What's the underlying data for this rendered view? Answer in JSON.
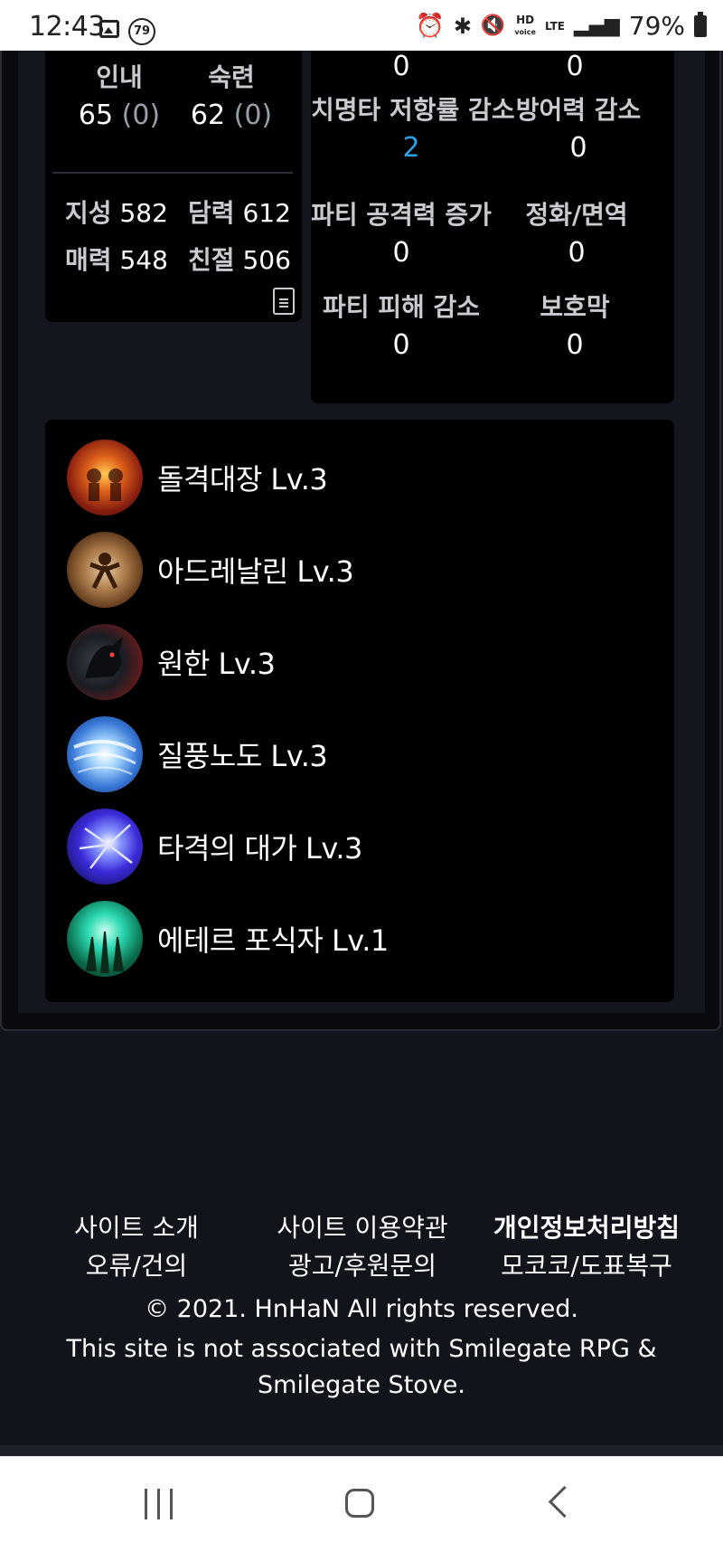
{
  "status_bar": {
    "time": "12:43",
    "notification_count": "79",
    "hd_label": "HD",
    "voice_label": "voice",
    "network_label": "LTE",
    "battery_percent": "79%"
  },
  "stats_card": {
    "stats": [
      {
        "label": "인내",
        "value": "65",
        "bonus": "(0)"
      },
      {
        "label": "숙련",
        "value": "62",
        "bonus": "(0)"
      }
    ],
    "tendencies": [
      {
        "label": "지성",
        "value": "582"
      },
      {
        "label": "담력",
        "value": "612"
      },
      {
        "label": "매력",
        "value": "548"
      },
      {
        "label": "친절",
        "value": "506"
      }
    ]
  },
  "combat_card": {
    "top_values": [
      "0",
      "0"
    ],
    "items": [
      {
        "label": "치명타 저항률 감소",
        "value": "2"
      },
      {
        "label": "방어력 감소",
        "value": "0"
      },
      {
        "label": "파티 공격력 증가",
        "value": "0"
      },
      {
        "label": "정화/면역",
        "value": "0"
      },
      {
        "label": "파티 피해 감소",
        "value": "0"
      },
      {
        "label": "보호막",
        "value": "0"
      }
    ],
    "highlight_color": "#2aa2e8"
  },
  "engravings": [
    {
      "name": "돌격대장 Lv.3",
      "icon": "charge-leader-icon"
    },
    {
      "name": "아드레날린 Lv.3",
      "icon": "adrenaline-icon"
    },
    {
      "name": "원한 Lv.3",
      "icon": "grudge-icon"
    },
    {
      "name": "질풍노도 Lv.3",
      "icon": "raging-wind-icon"
    },
    {
      "name": "타격의 대가 Lv.3",
      "icon": "master-of-strikes-icon"
    },
    {
      "name": "에테르 포식자 Lv.1",
      "icon": "ether-predator-icon"
    }
  ],
  "footer": {
    "links": [
      "사이트 소개",
      "사이트 이용약관",
      "개인정보처리방침",
      "오류/건의",
      "광고/후원문의",
      "모코코/도표복구"
    ],
    "copyright": "© 2021. HnHaN All rights reserved.",
    "notice": "This site is not associated with Smilegate RPG & Smilegate Stove."
  }
}
